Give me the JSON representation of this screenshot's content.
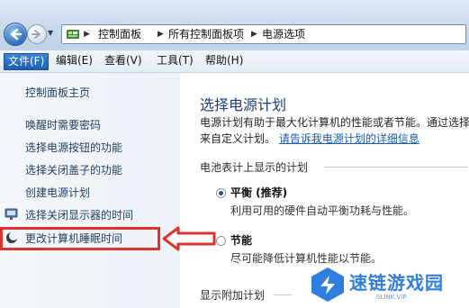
{
  "address_bar": {
    "breadcrumbs": [
      "控制面板",
      "所有控制面板项",
      "电源选项"
    ]
  },
  "menu": {
    "items": [
      {
        "label": "文件(F)",
        "active": true
      },
      {
        "label": "编辑(E)",
        "active": false
      },
      {
        "label": "查看(V)",
        "active": false
      },
      {
        "label": "工具(T)",
        "active": false
      },
      {
        "label": "帮助(H)",
        "active": false
      }
    ]
  },
  "sidebar": {
    "home_link": "控制面板主页",
    "links": [
      "唤醒时需要密码",
      "选择电源按钮的功能",
      "选择关闭盖子的功能",
      "创建电源计划",
      "选择关闭显示器的时间",
      "更改计算机睡眠时间"
    ],
    "highlighted_link_index": 5
  },
  "main": {
    "title": "选择电源计划",
    "intro_text": "电源计划有助于最大化计算机的性能或者节能。通过选择",
    "intro_text_2": "来自定义计划。",
    "intro_link": "请告诉我电源计划的详细信息",
    "battery_section_label": "电池表计上显示的计划",
    "plans": [
      {
        "name": "平衡 (推荐)",
        "description": "利用可用的硬件自动平衡功耗与性能。",
        "selected": true
      },
      {
        "name": "节能",
        "description": "尽可能降低计算机性能以节能。",
        "selected": false
      }
    ],
    "additional_section_label": "显示附加计划"
  },
  "watermark": {
    "text": "速链游戏园",
    "subtext": "SLINK.VIP"
  },
  "colors": {
    "highlight_red": "#e0302f",
    "link_blue": "#1a5bb5",
    "title_blue": "#1e3f78",
    "watermark_blue": "#2f7fe0"
  }
}
